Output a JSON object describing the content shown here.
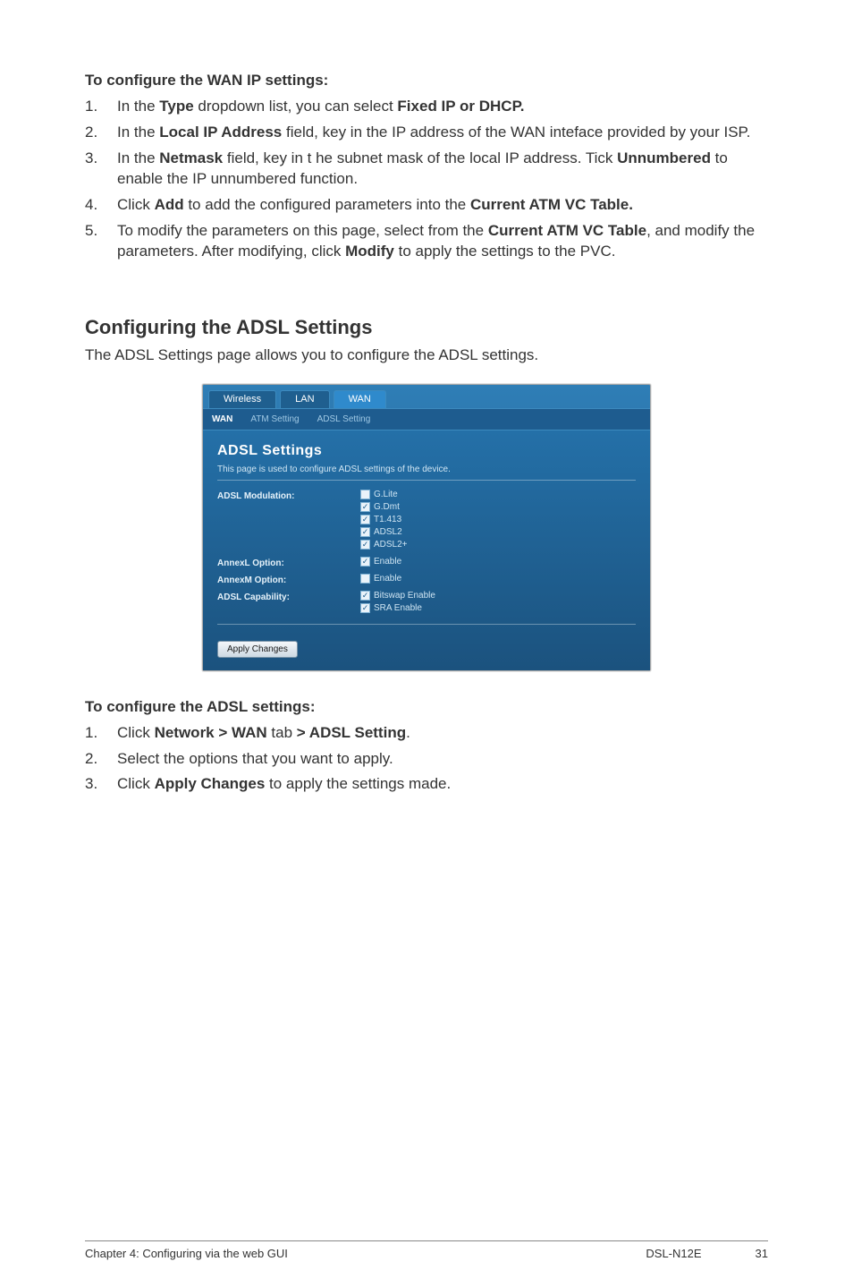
{
  "wanip": {
    "heading": "To configure the WAN IP settings:",
    "items": [
      {
        "num": "1.",
        "segments": [
          {
            "t": "In the "
          },
          {
            "t": "Type",
            "b": true
          },
          {
            "t": " dropdown list, you can select "
          },
          {
            "t": "Fixed IP or DHCP.",
            "b": true
          }
        ]
      },
      {
        "num": "2.",
        "segments": [
          {
            "t": "In the "
          },
          {
            "t": "Local IP Address",
            "b": true
          },
          {
            "t": " field, key in the IP address of the WAN inteface provided by your ISP."
          }
        ]
      },
      {
        "num": "3.",
        "segments": [
          {
            "t": "In the "
          },
          {
            "t": "Netmask",
            "b": true
          },
          {
            "t": " field, key in t he subnet mask of the local IP address. Tick "
          },
          {
            "t": "Unnumbered",
            "b": true
          },
          {
            "t": " to enable the IP unnumbered function."
          }
        ]
      },
      {
        "num": "4.",
        "segments": [
          {
            "t": "Click "
          },
          {
            "t": "Add",
            "b": true
          },
          {
            "t": " to add the configured parameters into the "
          },
          {
            "t": "Current ATM VC Table.",
            "b": true
          }
        ]
      },
      {
        "num": "5.",
        "segments": [
          {
            "t": "To modify the parameters on this page, select from the "
          },
          {
            "t": "Current ATM VC Table",
            "b": true
          },
          {
            "t": ", and modify the parameters. After modifying, click "
          },
          {
            "t": "Modify",
            "b": true
          },
          {
            "t": " to apply the settings to the PVC."
          }
        ]
      }
    ]
  },
  "adslSection": {
    "title": "Configuring the ADSL Settings",
    "lead": "The ADSL Settings page allows you to configure the ADSL settings."
  },
  "shot": {
    "tabs1": [
      "Wireless",
      "LAN",
      "WAN"
    ],
    "activeTab1Index": 2,
    "tabs2": [
      "WAN",
      "ATM Setting",
      "ADSL Setting"
    ],
    "panelTitle": "ADSL Settings",
    "panelDesc": "This page is used to configure ADSL settings of the device.",
    "groups": [
      {
        "label": "ADSL Modulation:",
        "options": [
          {
            "label": "G.Lite",
            "checked": false
          },
          {
            "label": "G.Dmt",
            "checked": true
          },
          {
            "label": "T1.413",
            "checked": true
          },
          {
            "label": "ADSL2",
            "checked": true
          },
          {
            "label": "ADSL2+",
            "checked": true
          }
        ]
      },
      {
        "label": "AnnexL Option:",
        "options": [
          {
            "label": "Enable",
            "checked": true
          }
        ]
      },
      {
        "label": "AnnexM Option:",
        "options": [
          {
            "label": "Enable",
            "checked": false
          }
        ]
      },
      {
        "label": "ADSL Capability:",
        "options": [
          {
            "label": "Bitswap Enable",
            "checked": true
          },
          {
            "label": "SRA Enable",
            "checked": true
          }
        ]
      }
    ],
    "button": "Apply Changes"
  },
  "adslSteps": {
    "heading": "To configure the ADSL settings:",
    "items": [
      {
        "num": "1.",
        "segments": [
          {
            "t": "Click "
          },
          {
            "t": "Network > WAN",
            "b": true
          },
          {
            "t": " tab "
          },
          {
            "t": "> ADSL Setting",
            "b": true
          },
          {
            "t": "."
          }
        ]
      },
      {
        "num": "2.",
        "segments": [
          {
            "t": "Select the options that you want to apply."
          }
        ]
      },
      {
        "num": "3.",
        "segments": [
          {
            "t": "Click "
          },
          {
            "t": "Apply Changes",
            "b": true
          },
          {
            "t": " to apply the settings made."
          }
        ]
      }
    ]
  },
  "footer": {
    "left": "Chapter 4: Configuring via the web GUI",
    "model": "DSL-N12E",
    "page": "31"
  }
}
